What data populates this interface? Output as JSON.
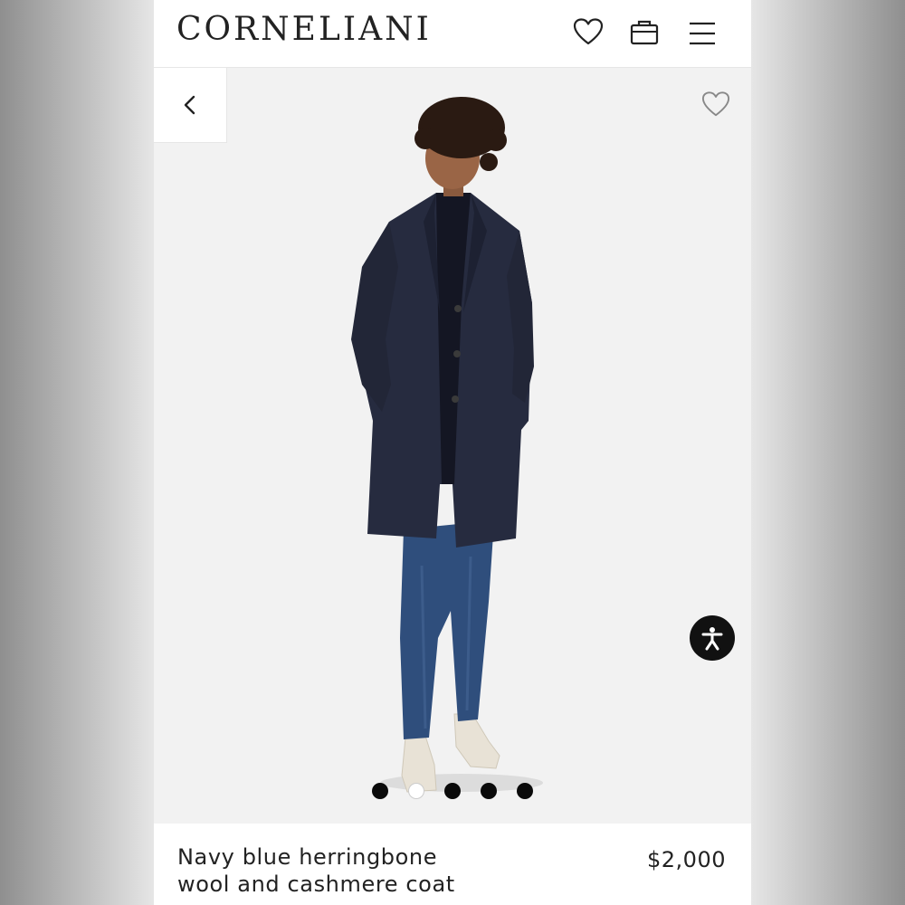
{
  "brand": {
    "logo_text": "CORNELIANI"
  },
  "header": {
    "icons": [
      "heart-icon",
      "shopping-bag-icon",
      "hamburger-menu-icon"
    ]
  },
  "gallery": {
    "image_count": 5,
    "active_index": 1,
    "image_subject": "model wearing navy coat, navy sweater, blue jeans, cream sneakers"
  },
  "product": {
    "name_line1": "Navy blue herringbone",
    "name_line2": "wool and cashmere coat",
    "price": "$2,000"
  },
  "colors": {
    "text": "#222222",
    "gallery_bg": "#f2f2f2",
    "coat": "#262b3f",
    "jeans": "#2f4e7c",
    "a11y_button": "#111111"
  }
}
